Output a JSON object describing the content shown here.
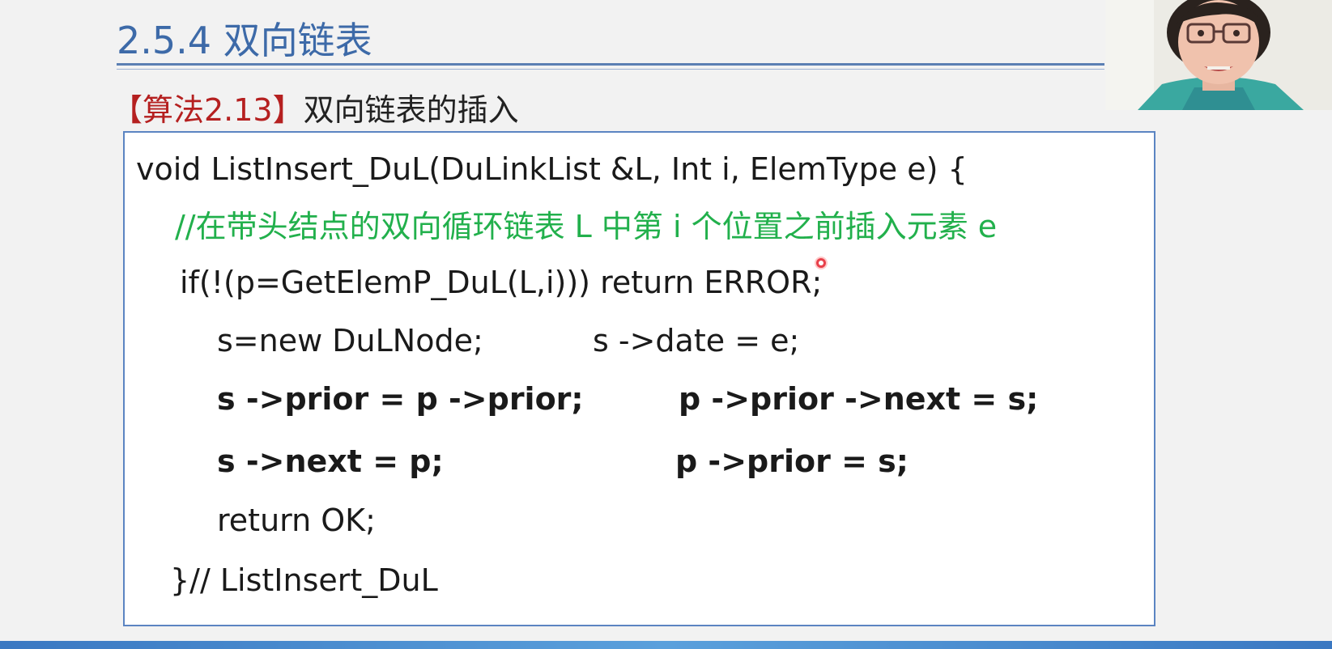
{
  "slide": {
    "title": "2.5.4 双向链表",
    "subtitle_tag": "【算法2.13】",
    "subtitle_text": "双向链表的插入"
  },
  "code": {
    "line1": "void ListInsert_DuL(DuLinkList &L, Int i, ElemType e) {",
    "line2": "//在带头结点的双向循环链表 L 中第 i 个位置之前插入元素 e",
    "line3": "if(!(p=GetElemP_DuL(L,i))) return ERROR;",
    "line4a": "s=new DuLNode;",
    "line4b": "s ->date = e;",
    "line5a": "s ->prior = p ->prior;",
    "line5b": "p ->prior ->next = s;",
    "line6a": "s ->next = p;",
    "line6b": "p ->prior = s;",
    "line7": "return OK;",
    "line8": "}// ListInsert_DuL"
  },
  "colors": {
    "title": "#3d6aa8",
    "tag": "#b52020",
    "comment": "#22b04c",
    "box_border": "#5b84c2"
  }
}
